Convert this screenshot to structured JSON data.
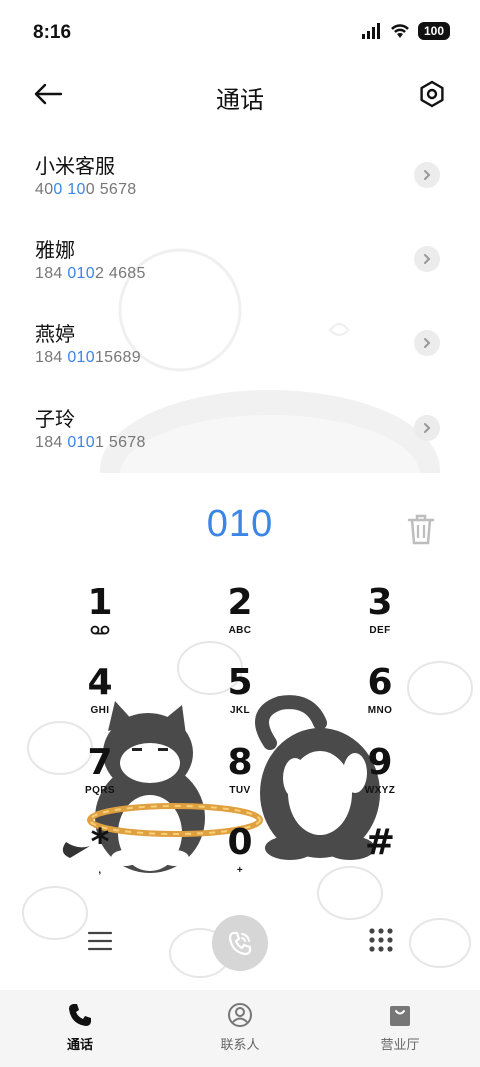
{
  "status_bar": {
    "time": "8:16",
    "battery": "100"
  },
  "header": {
    "title": "通话"
  },
  "contacts": [
    {
      "name": "小米客服",
      "number_pre": "40",
      "number_match": "0 10",
      "number_post": "0 5678"
    },
    {
      "name": "雅娜",
      "number_pre": "184 ",
      "number_match": "010",
      "number_post": "2 4685"
    },
    {
      "name": "燕婷",
      "number_pre": "184 ",
      "number_match": "010",
      "number_post": "15689"
    },
    {
      "name": "子玲",
      "number_pre": "184 ",
      "number_match": "010",
      "number_post": "1 5678"
    }
  ],
  "dialpad": {
    "dialed_number": "010",
    "keys": [
      {
        "digit": "1",
        "letters": ""
      },
      {
        "digit": "2",
        "letters": "ABC"
      },
      {
        "digit": "3",
        "letters": "DEF"
      },
      {
        "digit": "4",
        "letters": "GHI"
      },
      {
        "digit": "5",
        "letters": "JKL"
      },
      {
        "digit": "6",
        "letters": "MNO"
      },
      {
        "digit": "7",
        "letters": "PQRS"
      },
      {
        "digit": "8",
        "letters": "TUV"
      },
      {
        "digit": "9",
        "letters": "WXYZ"
      },
      {
        "digit": "*",
        "letters": ","
      },
      {
        "digit": "0",
        "letters": "+"
      },
      {
        "digit": "#",
        "letters": ""
      }
    ]
  },
  "bottom_nav": [
    {
      "label": "通话",
      "icon": "phone-icon",
      "active": true
    },
    {
      "label": "联系人",
      "icon": "person-icon",
      "active": false
    },
    {
      "label": "营业厅",
      "icon": "bag-icon",
      "active": false
    }
  ],
  "colors": {
    "accent": "#3a86e8",
    "call_button": "#d6d6d6"
  }
}
